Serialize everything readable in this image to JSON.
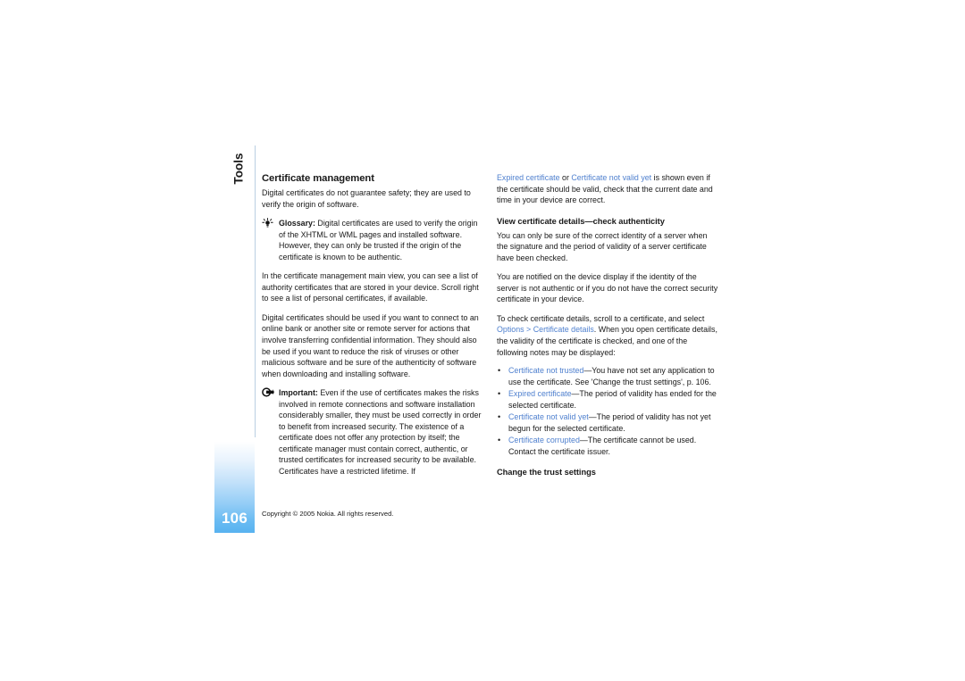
{
  "document": {
    "chapter": "Tools",
    "page_number": "106",
    "copyright": "Copyright © 2005 Nokia. All rights reserved.",
    "accent_link_color": "#5081cf",
    "tab_gradient_from": "#ffffff",
    "tab_gradient_to": "#58b2f0",
    "rule_color": "#b9cfe2"
  },
  "left_column": {
    "heading": "Certificate management",
    "intro": "Digital certificates do not guarantee safety; they are used to verify the origin of software.",
    "glossary_note": {
      "icon": "tip-bulb-icon",
      "label": "Glossary:",
      "text": "Digital certificates are used to verify the origin of the XHTML or WML pages and installed software. However, they can only be trusted if the origin of the certificate is known to be authentic."
    },
    "para_main_view": "In the certificate management main view, you can see a list of authority certificates that are stored in your device. Scroll right to see a list of personal certificates, if available.",
    "para_should_be_used": "Digital certificates should be used if you want to connect to an online bank or another site or remote server for actions that involve transferring confidential information. They should also be used if you want to reduce the risk of viruses or other malicious software and be sure of the authenticity of software when downloading and installing software.",
    "important_note": {
      "icon": "important-note-icon",
      "label": "Important:",
      "text": "Even if the use of certificates makes the risks involved in remote connections and software installation considerably smaller, they must be used correctly in order to benefit from increased security. The existence of a certificate does not offer any protection by itself; the certificate manager must contain correct, authentic, or trusted certificates for increased security to be available. Certificates have a restricted lifetime. If"
    }
  },
  "right_column": {
    "continued_paragraph": {
      "link_1": "Expired certificate",
      "mid_text": " or ",
      "link_2": "Certificate not valid yet",
      "tail_text": " is shown even if the certificate should be valid, check that the current date and time in your device are correct."
    },
    "heading_view_details": "View certificate details—check authenticity",
    "para_identity": "You can only be sure of the correct identity of a server when the signature and the period of validity of a server certificate have been checked.",
    "para_notified": "You are notified on the device display if the identity of the server is not authentic or if you do not have the correct security certificate in your device.",
    "para_to_check": {
      "lead": "To check certificate details, scroll to a certificate, and select ",
      "link_options": "Options",
      "separator": " > ",
      "link_details": "Certificate details",
      "tail": ". When you open certificate details, the validity of the certificate is checked, and one of the following notes may be displayed:"
    },
    "notes_list": [
      {
        "term": "Certificate not trusted",
        "description": "—You have not set any application to use the certificate. See 'Change the trust settings', p. 106."
      },
      {
        "term": "Expired certificate",
        "description": "—The period of validity has ended for the selected certificate."
      },
      {
        "term": "Certificate not valid yet",
        "description": "—The period of validity has not yet begun for the selected certificate."
      },
      {
        "term": "Certificate corrupted",
        "description": "—The certificate cannot be used. Contact the certificate issuer."
      }
    ],
    "heading_change_trust": "Change the trust settings"
  }
}
